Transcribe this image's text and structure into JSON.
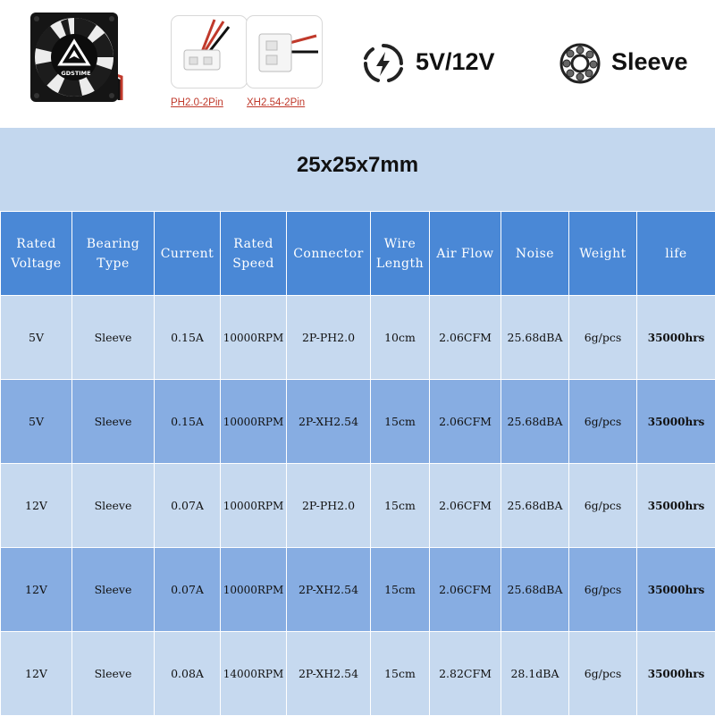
{
  "product": {
    "brand": "GDSTIME",
    "connectors": [
      {
        "label": "PH2.0-2Pin"
      },
      {
        "label": "XH2.54-2Pin"
      }
    ],
    "voltage": "5V/12V",
    "bearing": "Sleeve"
  },
  "dimensions": "25x25x7mm",
  "table": {
    "headers": [
      {
        "line1": "Rated",
        "line2": "Voltage"
      },
      {
        "line1": "Bearing",
        "line2": "Type"
      },
      {
        "line1": "Current",
        "line2": ""
      },
      {
        "line1": "Rated",
        "line2": "Speed"
      },
      {
        "line1": "Connector",
        "line2": ""
      },
      {
        "line1": "Wire",
        "line2": "Length"
      },
      {
        "line1": "Air Flow",
        "line2": ""
      },
      {
        "line1": "Noise",
        "line2": ""
      },
      {
        "line1": "Weight",
        "line2": ""
      },
      {
        "line1": "life",
        "line2": ""
      }
    ],
    "rows": [
      [
        "5V",
        "Sleeve",
        "0.15A",
        "10000RPM",
        "2P-PH2.0",
        "10cm",
        "2.06CFM",
        "25.68dBA",
        "6g/pcs",
        "35000hrs"
      ],
      [
        "5V",
        "Sleeve",
        "0.15A",
        "10000RPM",
        "2P-XH2.54",
        "15cm",
        "2.06CFM",
        "25.68dBA",
        "6g/pcs",
        "35000hrs"
      ],
      [
        "12V",
        "Sleeve",
        "0.07A",
        "10000RPM",
        "2P-PH2.0",
        "15cm",
        "2.06CFM",
        "25.68dBA",
        "6g/pcs",
        "35000hrs"
      ],
      [
        "12V",
        "Sleeve",
        "0.07A",
        "10000RPM",
        "2P-XH2.54",
        "15cm",
        "2.06CFM",
        "25.68dBA",
        "6g/pcs",
        "35000hrs"
      ],
      [
        "12V",
        "Sleeve",
        "0.08A",
        "14000RPM",
        "2P-XH2.54",
        "15cm",
        "2.82CFM",
        "28.1dBA",
        "6g/pcs",
        "35000hrs"
      ]
    ]
  },
  "colors": {
    "header_blue": "#4a88d6",
    "row_light": "#c6d9ef",
    "row_dark": "#87ade2",
    "panel": "#c3d7ee"
  }
}
